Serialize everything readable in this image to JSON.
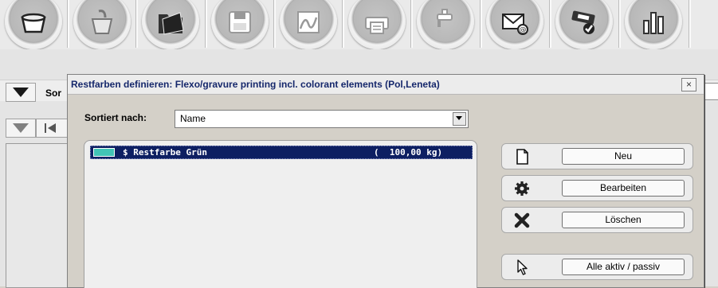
{
  "toolbar": {
    "buttons": [
      {
        "icon": "bowl-icon"
      },
      {
        "icon": "paint-cup-icon"
      },
      {
        "icon": "folder-open-icon"
      },
      {
        "icon": "floppy-disk-icon"
      },
      {
        "icon": "curve-chart-icon"
      },
      {
        "icon": "printer-icon"
      },
      {
        "icon": "faucet-icon"
      },
      {
        "icon": "email-icon"
      },
      {
        "icon": "scanner-check-icon"
      },
      {
        "icon": "bar-chart-icon"
      }
    ]
  },
  "background_app": {
    "sort_label": "Sor"
  },
  "dialog": {
    "title": "Restfarben definieren: Flexo/gravure printing incl. colorant elements  (Pol,Leneta)",
    "close_glyph": "×",
    "sort_label": "Sortiert nach:",
    "sort_value": "Name",
    "items": [
      {
        "swatch_color": "#42c4b6",
        "name": "$ Restfarbe Grün",
        "quantity": "(  100,00 kg)"
      }
    ],
    "actions": {
      "new_label": "Neu",
      "edit_label": "Bearbeiten",
      "delete_label": "Löschen",
      "toggle_label": "Alle aktiv / passiv"
    }
  },
  "colors": {
    "title_text": "#15276b",
    "selection": "#0d1f62"
  }
}
